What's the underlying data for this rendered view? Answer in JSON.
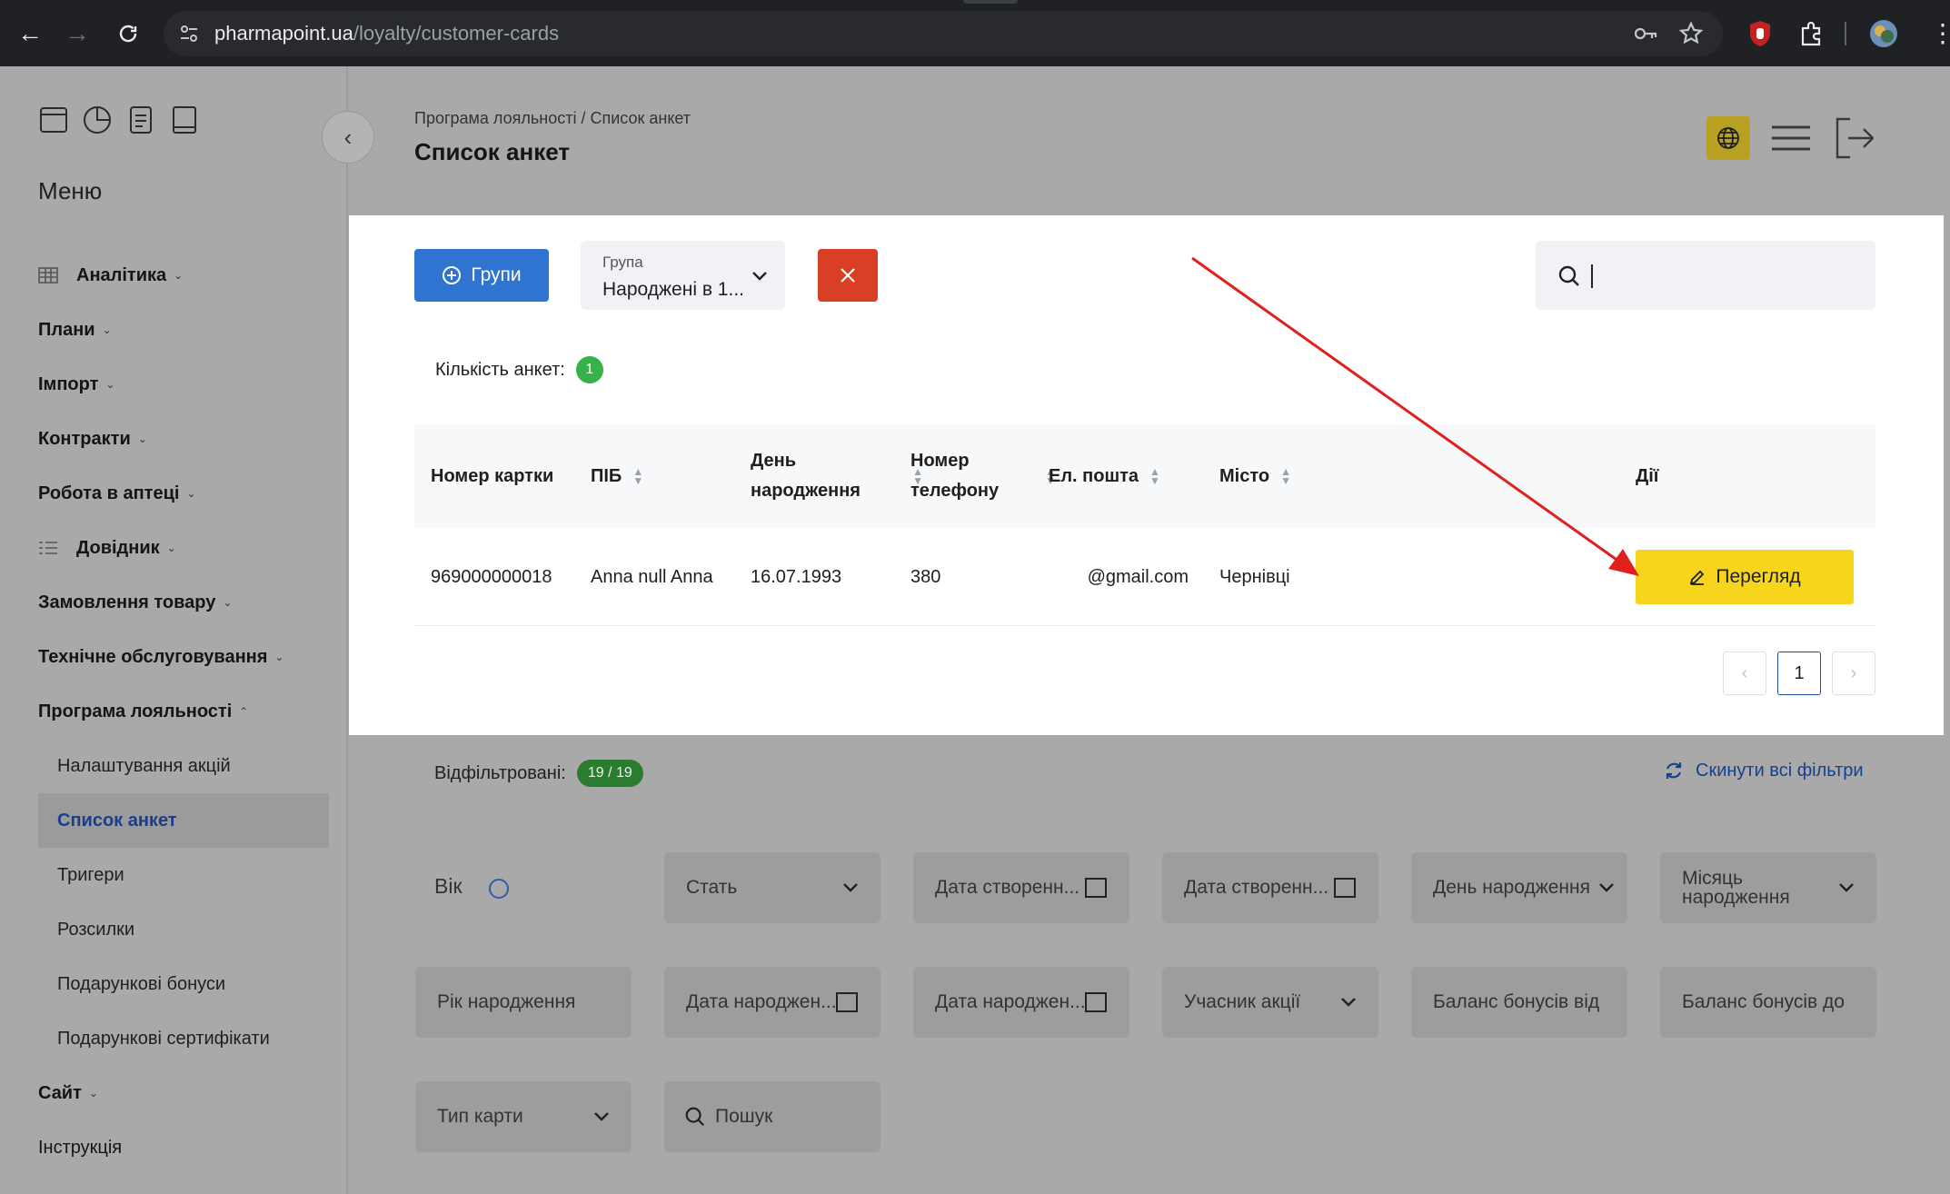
{
  "browser": {
    "url_domain": "pharmapoint.ua",
    "url_path": "/loyalty/customer-cards"
  },
  "sidebar": {
    "menu_title": "Меню",
    "items": [
      {
        "label": "Аналітика",
        "has_lead_icon": true
      },
      {
        "label": "Плани"
      },
      {
        "label": "Імпорт"
      },
      {
        "label": "Контракти"
      },
      {
        "label": "Робота в аптеці"
      },
      {
        "label": "Довідник",
        "has_lead_icon": true
      },
      {
        "label": "Замовлення товару"
      },
      {
        "label": "Технічне обслуговування"
      },
      {
        "label": "Програма лояльності",
        "expanded": true
      }
    ],
    "sub_items": [
      {
        "label": "Налаштування акцій"
      },
      {
        "label": "Список анкет",
        "active": true
      },
      {
        "label": "Тригери"
      },
      {
        "label": "Розсилки"
      },
      {
        "label": "Подарункові бонуси"
      },
      {
        "label": "Подарункові сертифікати"
      }
    ],
    "bottom_items": [
      {
        "label": "Сайт",
        "chevron": true
      },
      {
        "label": "Інструкція",
        "chevron": false
      }
    ]
  },
  "header": {
    "breadcrumb": "Програма лояльності / Список анкет",
    "title": "Список анкет"
  },
  "toolbar": {
    "groups_button": "Групи",
    "group_select_label": "Група",
    "group_select_value": "Народжені в 1...",
    "search_value": ""
  },
  "count": {
    "label": "Кількість анкет:",
    "value": "1"
  },
  "table": {
    "columns": [
      {
        "label": "Номер картки",
        "sortable": false
      },
      {
        "label": "ПІБ",
        "sortable": true
      },
      {
        "label": "День\nнародження",
        "sortable": true
      },
      {
        "label": "Номер\nтелефону",
        "sortable": true
      },
      {
        "label": "Ел. пошта",
        "sortable": true
      },
      {
        "label": "Місто",
        "sortable": true
      },
      {
        "label": "Дії",
        "sortable": false
      }
    ],
    "rows": [
      {
        "card": "969000000018",
        "name": "Anna null Anna",
        "birthday": "16.07.1993",
        "phone": "380",
        "email": "@gmail.com",
        "city": "Чернівці",
        "action": "Перегляд"
      }
    ]
  },
  "pagination": {
    "current": "1"
  },
  "filters": {
    "filtered_label": "Відфільтровані:",
    "filtered_value": "19 / 19",
    "reset_label": "Скинути всі фільтри",
    "age_label": "Вік",
    "fields": [
      {
        "label": "Стать",
        "kind": "select"
      },
      {
        "label": "Дата створенн...",
        "kind": "date"
      },
      {
        "label": "Дата створенн...",
        "kind": "date"
      },
      {
        "label": "День народження",
        "kind": "select"
      },
      {
        "label": "Місяць народження",
        "kind": "select"
      },
      {
        "label": "Рік народження",
        "kind": "text"
      },
      {
        "label": "Дата народжен...",
        "kind": "date"
      },
      {
        "label": "Дата народжен...",
        "kind": "date"
      },
      {
        "label": "Учасник акції",
        "kind": "select"
      },
      {
        "label": "Баланс бонусів від",
        "kind": "text"
      },
      {
        "label": "Баланс бонусів до",
        "kind": "text"
      },
      {
        "label": "Тип карти",
        "kind": "select"
      },
      {
        "label": "Пошук",
        "kind": "search"
      }
    ]
  },
  "colors": {
    "primary_blue": "#2f74d0",
    "danger_red": "#d93f25",
    "action_yellow": "#f7d51d",
    "badge_green": "#35b34a",
    "annotation_arrow": "#e0201c"
  }
}
